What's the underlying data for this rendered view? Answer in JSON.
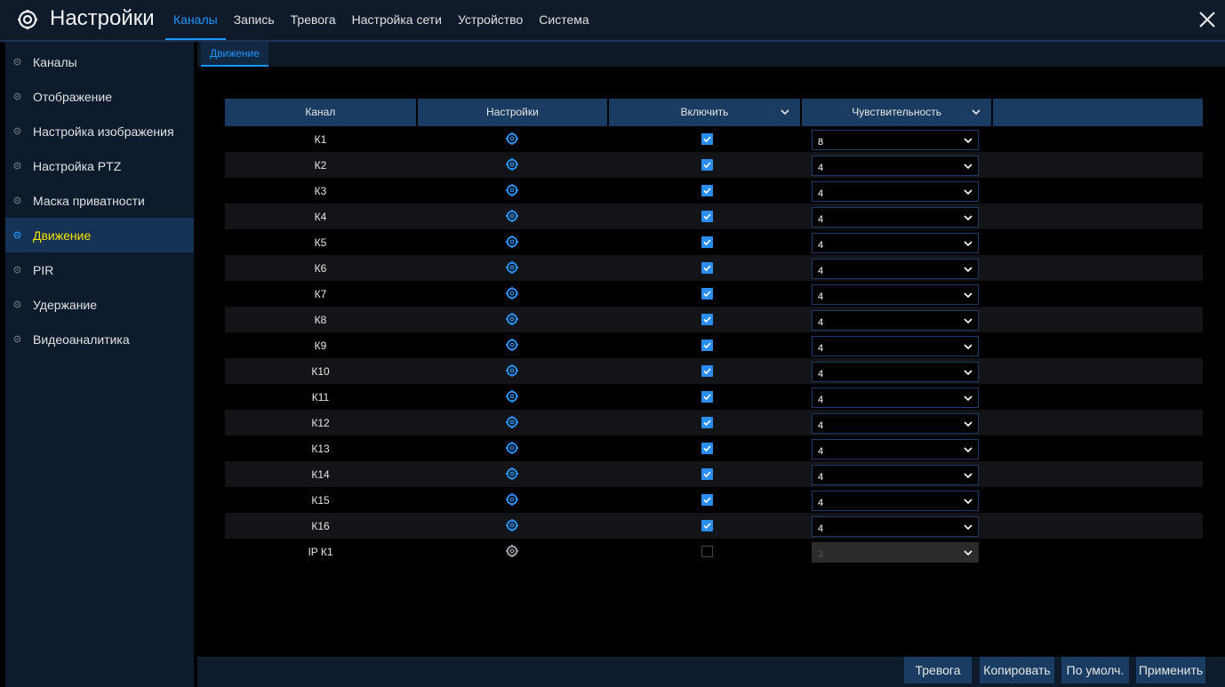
{
  "header": {
    "title": "Настройки",
    "app_icon": "gear-icon",
    "tabs": [
      {
        "label": "Каналы",
        "active": true
      },
      {
        "label": "Запись",
        "active": false
      },
      {
        "label": "Тревога",
        "active": false
      },
      {
        "label": "Настройка сети",
        "active": false
      },
      {
        "label": "Устройство",
        "active": false
      },
      {
        "label": "Система",
        "active": false
      }
    ],
    "close_icon": "close-icon"
  },
  "sidebar": {
    "items": [
      {
        "label": "Каналы",
        "active": false
      },
      {
        "label": "Отображение",
        "active": false
      },
      {
        "label": "Настройка изображения",
        "active": false
      },
      {
        "label": "Настройка PTZ",
        "active": false
      },
      {
        "label": "Маска приватности",
        "active": false
      },
      {
        "label": "Движение",
        "active": true
      },
      {
        "label": "PIR",
        "active": false
      },
      {
        "label": "Удержание",
        "active": false
      },
      {
        "label": "Видеоаналитика",
        "active": false
      }
    ]
  },
  "subtab": {
    "label": "Движение"
  },
  "table": {
    "columns": [
      "Канал",
      "Настройки",
      "Включить",
      "Чувствительность"
    ],
    "rows": [
      {
        "channel": "К1",
        "enabled": true,
        "sensitivity": "8"
      },
      {
        "channel": "К2",
        "enabled": true,
        "sensitivity": "4"
      },
      {
        "channel": "К3",
        "enabled": true,
        "sensitivity": "4"
      },
      {
        "channel": "К4",
        "enabled": true,
        "sensitivity": "4"
      },
      {
        "channel": "К5",
        "enabled": true,
        "sensitivity": "4"
      },
      {
        "channel": "К6",
        "enabled": true,
        "sensitivity": "4"
      },
      {
        "channel": "К7",
        "enabled": true,
        "sensitivity": "4"
      },
      {
        "channel": "К8",
        "enabled": true,
        "sensitivity": "4"
      },
      {
        "channel": "К9",
        "enabled": true,
        "sensitivity": "4"
      },
      {
        "channel": "К10",
        "enabled": true,
        "sensitivity": "4"
      },
      {
        "channel": "К11",
        "enabled": true,
        "sensitivity": "4"
      },
      {
        "channel": "К12",
        "enabled": true,
        "sensitivity": "4"
      },
      {
        "channel": "К13",
        "enabled": true,
        "sensitivity": "4"
      },
      {
        "channel": "К14",
        "enabled": true,
        "sensitivity": "4"
      },
      {
        "channel": "К15",
        "enabled": true,
        "sensitivity": "4"
      },
      {
        "channel": "К16",
        "enabled": true,
        "sensitivity": "4"
      },
      {
        "channel": "IP К1",
        "enabled": false,
        "sensitivity": "3",
        "disabled": true
      }
    ]
  },
  "footer": {
    "alarm": "Тревога",
    "copy": "Копировать",
    "default": "По умолч.",
    "apply": "Применить"
  },
  "colors": {
    "accent": "#1e96ff",
    "active_sidebar_text": "#f2e000",
    "header_bg": "#1a3c62"
  }
}
